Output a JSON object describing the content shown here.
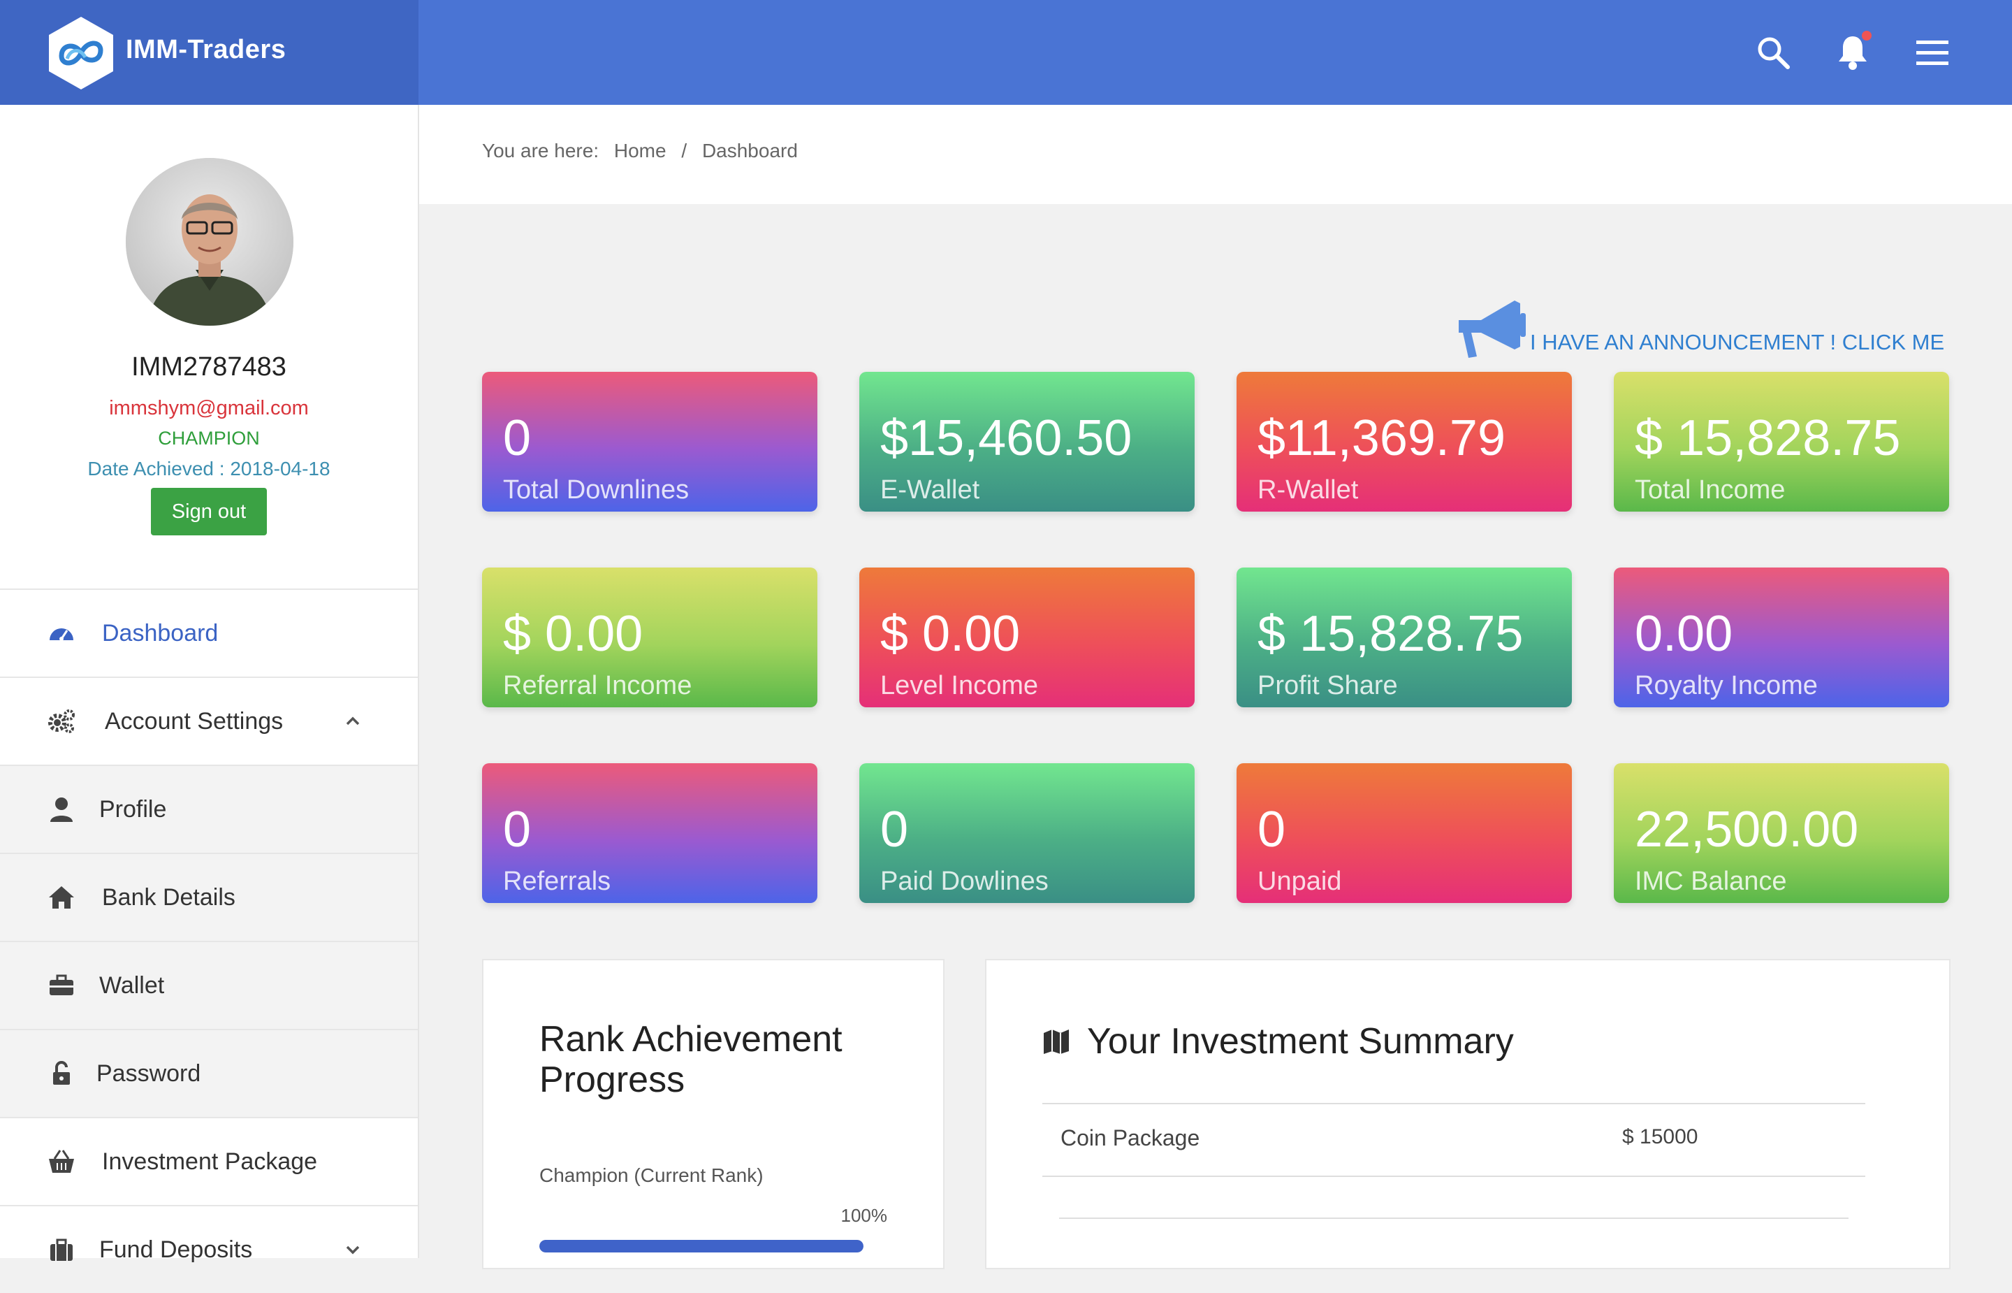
{
  "brand": {
    "name": "IMM-Traders"
  },
  "user": {
    "id": "IMM2787483",
    "email": "immshym@gmail.com",
    "rank": "CHAMPION",
    "date_achieved": "Date Achieved : 2018-04-18",
    "signout_label": "Sign out"
  },
  "sidebar": {
    "items": [
      {
        "label": "Dashboard",
        "icon": "dashboard-gauge-icon"
      },
      {
        "label": "Account Settings",
        "icon": "gears-icon"
      },
      {
        "label": "Profile",
        "icon": "user-icon"
      },
      {
        "label": "Bank Details",
        "icon": "home-icon"
      },
      {
        "label": "Wallet",
        "icon": "briefcase-icon"
      },
      {
        "label": "Password",
        "icon": "lock-icon"
      },
      {
        "label": "Investment Package",
        "icon": "basket-icon"
      },
      {
        "label": "Fund Deposits",
        "icon": "suitcase-icon"
      }
    ]
  },
  "breadcrumb": {
    "prefix": "You are here:",
    "home": "Home",
    "sep": "/",
    "current": "Dashboard"
  },
  "announcement": {
    "text": "I HAVE AN ANNOUNCEMENT ! CLICK ME"
  },
  "cards": [
    {
      "value": "0",
      "label": "Total Downlines"
    },
    {
      "value": "$15,460.50",
      "label": "E-Wallet"
    },
    {
      "value": "$11,369.79",
      "label": "R-Wallet"
    },
    {
      "value": "$ 15,828.75",
      "label": "Total Income"
    },
    {
      "value": "$ 0.00",
      "label": "Referral Income"
    },
    {
      "value": "$ 0.00",
      "label": "Level Income"
    },
    {
      "value": "$ 15,828.75",
      "label": "Profit Share"
    },
    {
      "value": "0.00",
      "label": "Royalty Income"
    },
    {
      "value": "0",
      "label": "Referrals"
    },
    {
      "value": "0",
      "label": "Paid Dowlines"
    },
    {
      "value": "0",
      "label": "Unpaid"
    },
    {
      "value": "22,500.00",
      "label": "IMC Balance"
    }
  ],
  "rank_panel": {
    "title": "Rank Achievement Progress",
    "current_label": "Champion (Current Rank)",
    "percent_label": "100%",
    "progress": 1.0
  },
  "investment": {
    "title": "Your Investment Summary",
    "rows": [
      {
        "name": "Coin Package",
        "value": "$ 15000"
      }
    ]
  },
  "colors": {
    "brand": "#3f66c3",
    "topbar": "#4a74d4",
    "active": "#3b63c4",
    "signout": "#3ba244",
    "announcement": "#2f7fd0"
  }
}
